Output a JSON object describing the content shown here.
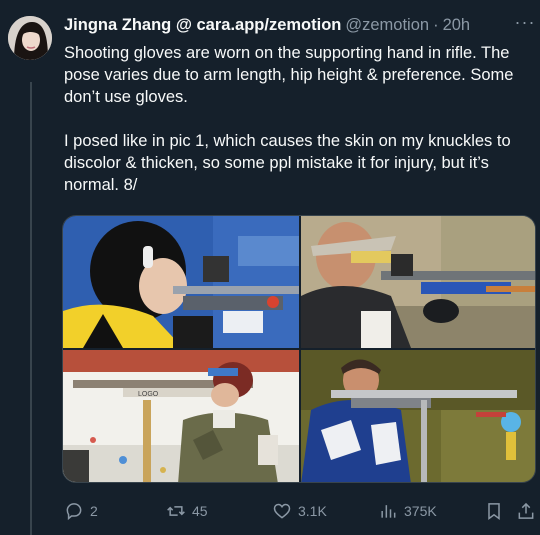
{
  "tweet": {
    "author_name": "Jingna Zhang @ cara.app/zemotion",
    "handle": "@zemotion",
    "separator": "·",
    "time": "20h",
    "more_label": "···",
    "paragraphs": [
      "Shooting gloves are worn on the supporting hand in rifle. The pose varies due to arm length, hip height & preference. Some don’t use gloves.",
      "I posed like in pic 1, which causes the skin on my knuckles to discolor & thicken, so some ppl mistake it for injury, but it’s normal. 8/"
    ]
  },
  "photos": [
    {
      "icon": "rifle-shooter-photo-1"
    },
    {
      "icon": "rifle-shooter-photo-2"
    },
    {
      "icon": "rifle-shooter-photo-3",
      "rifle_text": "LOGO"
    },
    {
      "icon": "rifle-shooter-photo-4"
    }
  ],
  "actions": {
    "reply_count": "2",
    "retweet_count": "45",
    "like_count": "3.1K",
    "view_count": "375K"
  },
  "colors": {
    "background": "#15202b",
    "text": "#f7f9f9",
    "muted": "#8b98a5",
    "border": "#38444d"
  }
}
